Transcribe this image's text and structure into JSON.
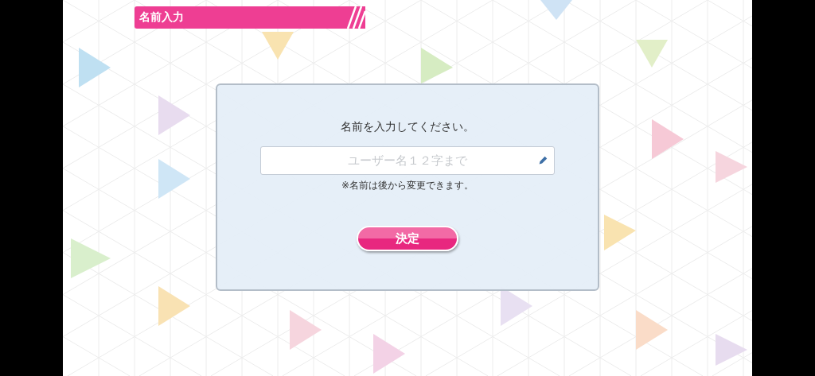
{
  "header": {
    "title": "名前入力"
  },
  "dialog": {
    "prompt": "名前を入力してください。",
    "name_field": {
      "placeholder": "ユーザー名１２字まで"
    },
    "note": "※名前は後から変更できます。",
    "confirm_button": "決定"
  }
}
